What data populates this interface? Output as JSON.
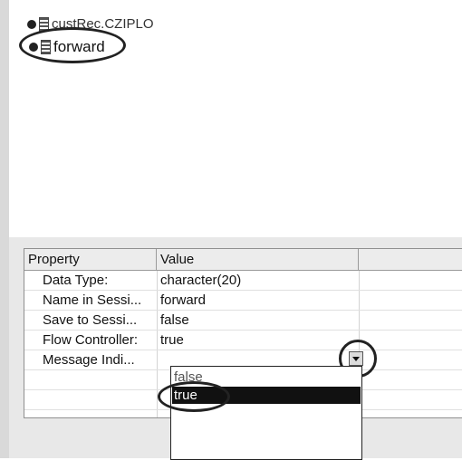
{
  "tree": {
    "items": [
      {
        "label": "custRec.CZIPLO"
      },
      {
        "label": "forward"
      }
    ]
  },
  "properties": {
    "headers": {
      "property": "Property",
      "value": "Value"
    },
    "rows": [
      {
        "key": "Data Type:",
        "value": "character(20)"
      },
      {
        "key": "Name in Sessi...",
        "value": "forward"
      },
      {
        "key": "Save to Sessi...",
        "value": "false"
      },
      {
        "key": "Flow Controller:",
        "value": "true"
      },
      {
        "key": "Message Indi...",
        "value": ""
      }
    ]
  },
  "dropdown": {
    "options": [
      "false",
      "true"
    ],
    "selected": "true"
  }
}
